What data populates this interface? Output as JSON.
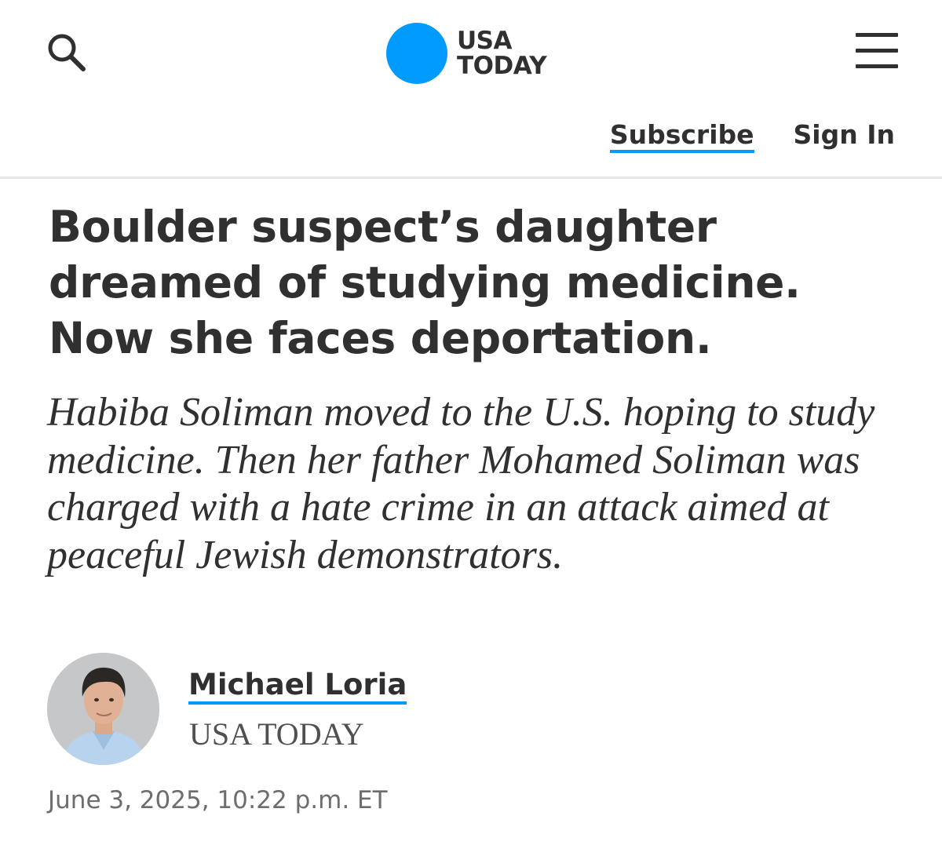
{
  "header": {
    "search_icon": "search-icon",
    "menu_icon": "hamburger-menu-icon",
    "logo": {
      "line1": "USA",
      "line2": "TODAY",
      "dot_color": "#009bff"
    },
    "subscribe_label": "Subscribe",
    "sign_in_label": "Sign In"
  },
  "article": {
    "headline": "Boulder suspect’s daughter dreamed of studying medicine. Now she faces deportation.",
    "dek": "Habiba Soliman moved to the U.S. hoping to study medicine. Then her father Mohamed Soliman was charged with a hate crime in an attack aimed at peaceful Jewish demonstrators.",
    "author": {
      "name": "Michael Loria",
      "organization": "USA TODAY"
    },
    "date": "June 3, 2025, 10:22 p.m. ET"
  },
  "colors": {
    "accent": "#009bff",
    "text": "#303030",
    "muted": "#6d6d6d"
  }
}
